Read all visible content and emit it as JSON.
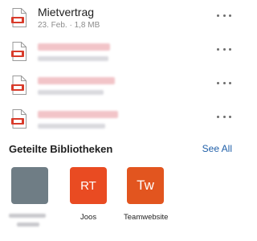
{
  "files": [
    {
      "name": "Mietvertrag",
      "meta": "23. Feb. · 1,8 MB",
      "redacted": false,
      "icon": "pdf-file-icon"
    },
    {
      "name": "",
      "meta": "",
      "redacted": true,
      "icon": "pdf-file-icon"
    },
    {
      "name": "",
      "meta": "",
      "redacted": true,
      "icon": "pdf-file-icon"
    },
    {
      "name": "",
      "meta": "",
      "redacted": true,
      "icon": "pdf-file-icon"
    }
  ],
  "shared_libraries": {
    "title": "Geteilte Bibliotheken",
    "see_all": "See All",
    "items": [
      {
        "initials": "",
        "label": "",
        "color": "#6f7d85",
        "redacted": true
      },
      {
        "initials": "RT",
        "label": "Joos",
        "color": "#e94b22",
        "redacted": false
      },
      {
        "initials": "Tw",
        "label": "Teamwebsite",
        "color": "#e2551f",
        "redacted": false
      }
    ]
  },
  "colors": {
    "pdf_red": "#d83b2b",
    "link_blue": "#1f5fa8"
  }
}
